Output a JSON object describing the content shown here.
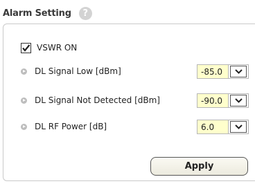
{
  "section": {
    "title": "Alarm Setting",
    "help_icon": "question-mark-icon"
  },
  "vswr": {
    "label": "VSWR ON",
    "checked": true
  },
  "settings": [
    {
      "label": "DL Signal Low [dBm]",
      "value": "-85.0"
    },
    {
      "label": "DL Signal Not Detected [dBm]",
      "value": "-90.0"
    },
    {
      "label": "DL RF Power [dB]",
      "value": "6.0"
    }
  ],
  "actions": {
    "apply_label": "Apply"
  },
  "colors": {
    "select_bg": "#ffffcc",
    "panel_border": "#c9c9c9",
    "help_icon_bg": "#d3d3d3"
  }
}
